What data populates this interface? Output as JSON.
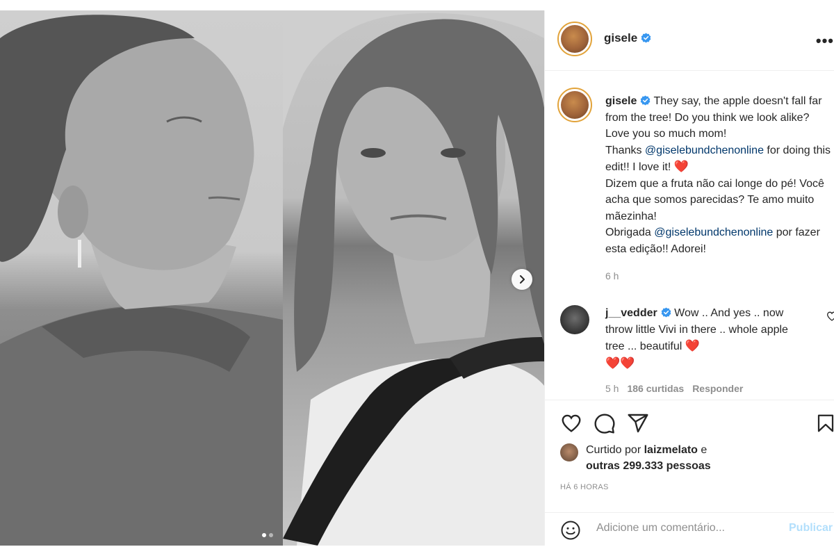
{
  "post": {
    "username": "gisele",
    "more_icon": "more-horizontal-icon",
    "caption": {
      "username": "gisele",
      "line1": "They say, the apple doesn't fall far from the tree! Do you think we look alike? Love you so much mom!",
      "thanks_prefix": "Thanks ",
      "mention1": "@giselebundchenonline",
      "thanks_suffix": " for doing this edit!! I love it! ",
      "heart": "❤️",
      "pt_line": "Dizem que a fruta não cai longe do pé! Você acha que somos parecidas? Te amo muito mãezinha!",
      "obrigada_prefix": "Obrigada ",
      "mention2": "@giselebundchenonline",
      "obrigada_suffix": " por fazer esta edição!! Adorei!"
    },
    "caption_time": "6 h"
  },
  "comment": {
    "username": "j__vedder",
    "text": " Wow .. And yes .. now throw little Vivi in there .. whole apple tree ... beautiful ",
    "hearts_inline": "❤️",
    "hearts_line": "❤️❤️",
    "time": "5 h",
    "likes": "186 curtidas",
    "reply": "Responder"
  },
  "likes": {
    "prefix": "Curtido por ",
    "user": "laizmelato",
    "middle": " e",
    "others": "outras 299.333 pessoas"
  },
  "post_time": "HÁ 6 HORAS",
  "add_comment": {
    "placeholder": "Adicione um comentário...",
    "publish": "Publicar"
  },
  "carousel": {
    "index": 1,
    "total": 2
  },
  "colors": {
    "link": "#00376b",
    "verified": "#3897f0",
    "heart": "#e0102b",
    "publish_disabled": "#b2dffc"
  }
}
